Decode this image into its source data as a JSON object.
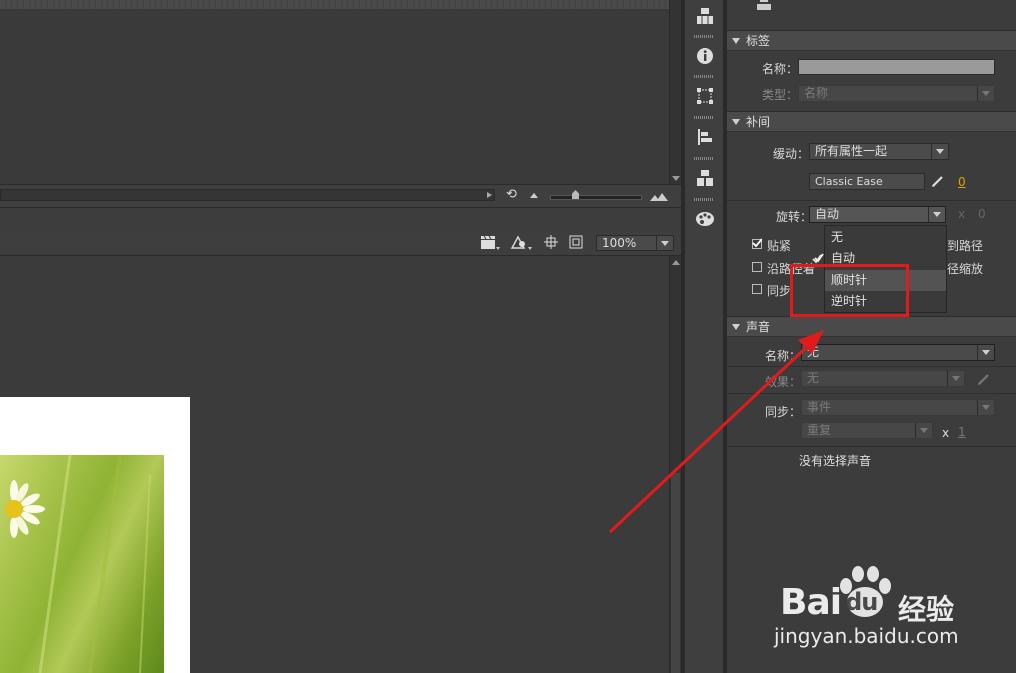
{
  "stage": {
    "zoom_value": "100%"
  },
  "labels": {
    "name_label": "名称：",
    "type_label": "类型：",
    "type_value": "名称"
  },
  "tween": {
    "ease_label": "缓动：",
    "ease_value": "所有属性一起",
    "classic_ease": "Classic Ease",
    "ease_number": "0",
    "rotate_label": "旋转：",
    "rotate_value": "自动",
    "rotate_x": "x",
    "rotate_count": "0",
    "snap_label": "贴紧",
    "path_orient_label": "沿路径着",
    "sync_label": "同步",
    "path_right_1": "到路径",
    "path_right_2": "径缩放"
  },
  "rotate_menu": {
    "items": [
      "无",
      "自动",
      "顺时针",
      "逆时针"
    ],
    "checked_index": 1
  },
  "sound": {
    "name_label": "名称：",
    "name_value": "无",
    "effect_label": "效果：",
    "effect_value": "无",
    "sync_label": "同步：",
    "sync_value": "事件",
    "repeat_value": "重复",
    "repeat_x": "x",
    "repeat_count": "1",
    "no_sound_text": "没有选择声音"
  },
  "sections": {
    "label_title": "标签",
    "tween_title": "补间",
    "sound_title": "声音"
  },
  "watermark": {
    "brand": "Bai",
    "brand_du": "du",
    "cn": "经验",
    "url": "jingyan.baidu.com"
  },
  "colors": {
    "panel_bg": "#3b3b3b",
    "highlight_box": "#e11b1b",
    "arrow": "#e11b1b"
  }
}
